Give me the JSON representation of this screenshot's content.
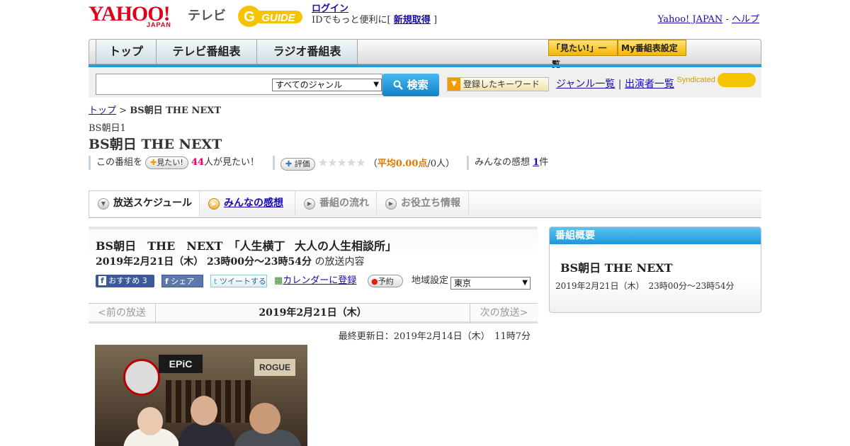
{
  "header": {
    "logo_yahoo": "YAHOO!",
    "logo_japan": "JAPAN",
    "logo_tv": "テレビ",
    "gguide_logo": "GUIDE",
    "login_label": "ログイン",
    "login_hint": "IDでもっと便利に[",
    "register_label": "新規取得",
    "login_hint_end": "]",
    "yahoo_japan_link": "Yahoo! JAPAN",
    "link_separator": "-",
    "help_link": "ヘルプ"
  },
  "nav": {
    "tabs": [
      "トップ",
      "テレビ番組表",
      "ラジオ番組表"
    ],
    "mitai_list_button": "「見たい!」一覧",
    "my_schedule_button": "My番組表設定",
    "accent_color": "#1f9fe3"
  },
  "search": {
    "input_value": "",
    "genre_selected": "すべてのジャンル",
    "search_button": "検索",
    "keyword_button": "登録したキーワード",
    "genre_list_link": "ジャンル一覧",
    "separator": "|",
    "cast_list_link": "出演者一覧",
    "syndicated_label": "Syndicated"
  },
  "breadcrumb": {
    "home": "トップ",
    "separator": ">",
    "current": "BS朝日 THE NEXT"
  },
  "program": {
    "channel": "BS朝日1",
    "title": "BS朝日 THE NEXT",
    "mitai_prefix": "この番組を",
    "mitai_button": "見たい!",
    "mitai_count": "44",
    "mitai_suffix": "人が見たい！",
    "rate_button": "評価",
    "stars_text": "★★★★★",
    "rating_open": "（",
    "rating_avg": "平均0.00点",
    "rating_people": "/0人）",
    "impressions_label": "みんなの感想",
    "impressions_count": "1",
    "impressions_unit": "件"
  },
  "content_tabs": [
    {
      "label": "放送スケジュール",
      "state": "active"
    },
    {
      "label": "みんなの感想",
      "state": "link"
    },
    {
      "label": "番組の流れ",
      "state": "disabled"
    },
    {
      "label": "お役立ち情報",
      "state": "disabled"
    }
  ],
  "broadcast": {
    "episode_title": "BS朝日　THE　NEXT　「人生横丁 大人の人生相談所」",
    "datetime": "2019年2月21日（木） 23時00分～23時54分",
    "datetime_suffix": "の放送内容",
    "fb_recommend": "おすすめ 3",
    "fb_share": "シェア",
    "tweet": "ツイートする",
    "calendar": "カレンダーに登録",
    "reserve": "予約",
    "region_label": "地域設定",
    "region_selected": "東京",
    "prev": "<前の放送",
    "current_date": "2019年2月21日（木）",
    "next": "次の放送>",
    "updated": "最終更新日：2019年2月14日（木）　11時7分"
  },
  "photo": {
    "sign_epic": "EPiC",
    "sign_rogue": "ROGUE"
  },
  "sidebar": {
    "heading": "番組概要",
    "title": "BS朝日 THE NEXT",
    "datetime": "2019年2月21日（木）　23時00分～23時54分"
  }
}
